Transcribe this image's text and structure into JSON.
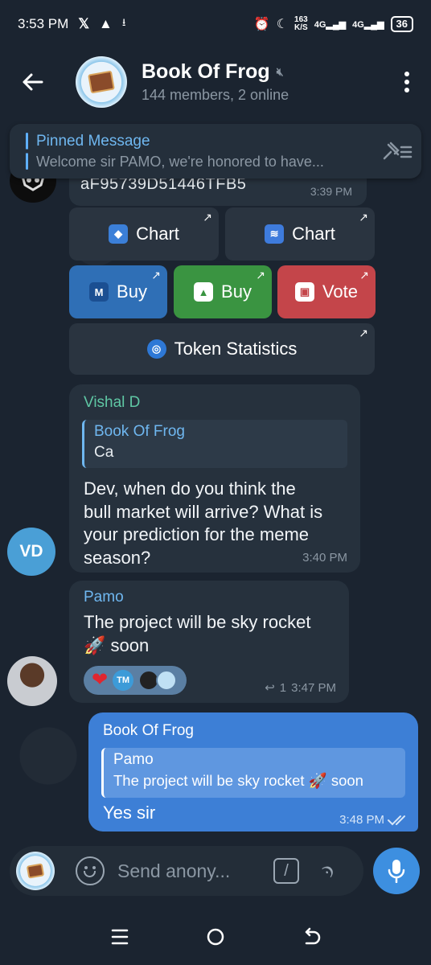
{
  "status_bar": {
    "time": "3:53 PM",
    "left_icons": [
      "x-logo",
      "warning",
      "download"
    ],
    "net_speed": "163",
    "net_unit": "K/S",
    "network_1": "4G",
    "network_2": "4G",
    "battery": "36"
  },
  "header": {
    "title": "Book Of Frog",
    "subtitle": "144 members, 2 online"
  },
  "pinned": {
    "label": "Pinned Message",
    "text": "Welcome sir PAMO, we're honored to have..."
  },
  "partial_message": {
    "text": "aF95739D51446TFB5",
    "time": "3:39 PM"
  },
  "keyboard": {
    "chart_1": "Chart",
    "chart_2": "Chart",
    "buy_1": "Buy",
    "buy_2": "Buy",
    "vote": "Vote",
    "token_stats": "Token Statistics"
  },
  "messages": [
    {
      "sender": "Vishal D",
      "sender_color": "#5fc7a4",
      "avatar_initials": "VD",
      "reply_name": "Book Of Frog",
      "reply_text": "Ca",
      "lines": [
        "Dev, when do you think the",
        "bull market will arrive? What is",
        "your prediction for the meme",
        "season?"
      ],
      "time": "3:40 PM"
    },
    {
      "sender": "Pamo",
      "sender_color": "#6fb7f0",
      "lines": [
        "The project will be sky rocket",
        "🚀 soon"
      ],
      "reply_count": "1",
      "time": "3:47 PM",
      "reactions": {
        "heart": "❤",
        "initials": "TM"
      }
    }
  ],
  "outgoing": {
    "sender": "Book Of Frog",
    "reply_name": "Pamo",
    "reply_text": "The project will be sky rocket 🚀 soon",
    "text": "Yes sir",
    "time": "3:48 PM"
  },
  "composer": {
    "placeholder": "Send anony..."
  }
}
